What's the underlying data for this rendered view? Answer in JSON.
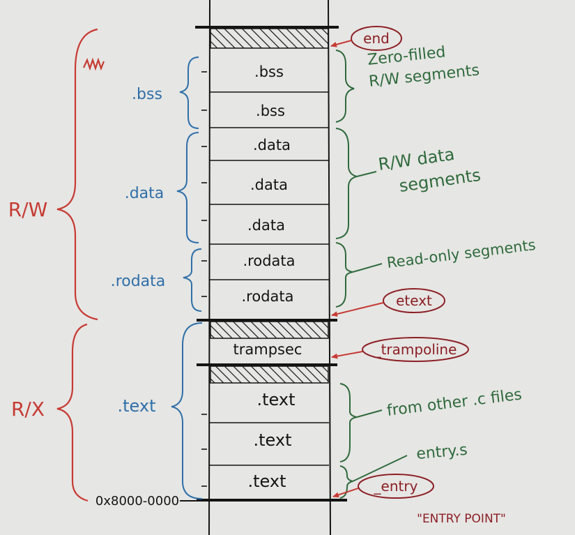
{
  "colors": {
    "paper": "#e6e6e4",
    "ink": "#141414",
    "blue": "#2f6fa8",
    "green": "#2f6a3c",
    "red": "#c63b34",
    "maroon": "#8c1f25"
  },
  "memory_segments": {
    "bss_1": ".bss",
    "bss_2": ".bss",
    "data_1": ".data",
    "data_2": ".data",
    "data_3": ".data",
    "rodata_1": ".rodata",
    "rodata_2": ".rodata",
    "trampsec": "trampsec",
    "text_1": ".text",
    "text_2": ".text",
    "text_3": ".text"
  },
  "section_labels": {
    "bss": ".bss",
    "data": ".data",
    "rodata": ".rodata",
    "text": ".text"
  },
  "permission_labels": {
    "rw": "R/W",
    "rx": "R/X"
  },
  "annotations": {
    "zero_filled_line1": "Zero-filled",
    "zero_filled_line2": "R/W segments",
    "rw_data_line1": "R/W data",
    "rw_data_line2": "segments",
    "read_only": "Read-only segments",
    "from_other": "from other .c files",
    "entry_s": "entry.s",
    "entry_point": "\"ENTRY POINT\""
  },
  "symbols": {
    "end": "end",
    "etext": "etext",
    "trampoline": "_trampoline",
    "entry": "_entry"
  },
  "base_address": "0x8000-0000"
}
